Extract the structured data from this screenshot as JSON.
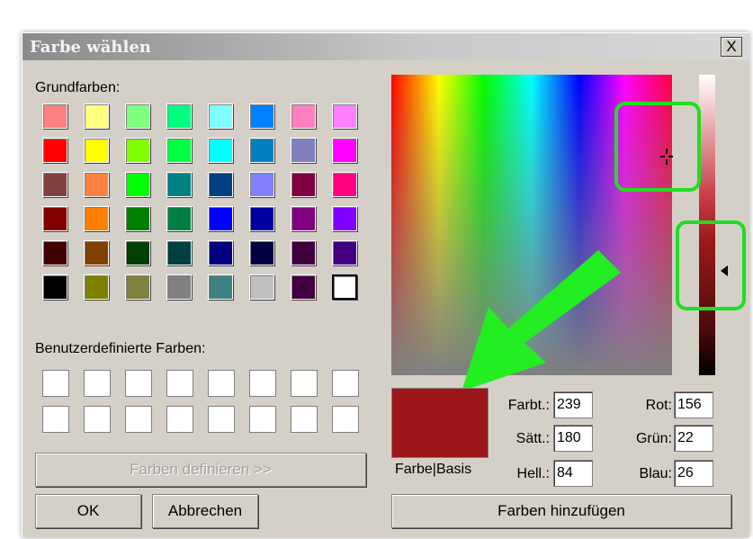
{
  "dialog": {
    "title": "Farbe wählen",
    "close_label": "X",
    "basic_colors_label": "Grundfarben:",
    "custom_colors_label": "Benutzerdefinierte Farben:",
    "define_button": "Farben definieren >>",
    "ok_button": "OK",
    "cancel_button": "Abbrechen",
    "add_button": "Farben hinzufügen",
    "preview_label": "Farbe|Basis"
  },
  "basic_colors": [
    [
      "#ff8080",
      "#ffff80",
      "#80ff80",
      "#00ff80",
      "#80ffff",
      "#0080ff",
      "#ff80c0",
      "#ff80ff"
    ],
    [
      "#ff0000",
      "#ffff00",
      "#80ff00",
      "#00ff40",
      "#00ffff",
      "#0080c0",
      "#8080c0",
      "#ff00ff"
    ],
    [
      "#804040",
      "#ff8040",
      "#00ff00",
      "#008080",
      "#004080",
      "#8080ff",
      "#800040",
      "#ff0080"
    ],
    [
      "#800000",
      "#ff8000",
      "#008000",
      "#008040",
      "#0000ff",
      "#0000a0",
      "#800080",
      "#8000ff"
    ],
    [
      "#400000",
      "#804000",
      "#004000",
      "#004040",
      "#000080",
      "#000040",
      "#400040",
      "#400080"
    ],
    [
      "#000000",
      "#808000",
      "#808040",
      "#808080",
      "#408080",
      "#c0c0c0",
      "#400040",
      "#ffffff"
    ]
  ],
  "fields": {
    "hue": {
      "label": "Farbt.:",
      "value": "239"
    },
    "sat": {
      "label": "Sätt.:",
      "value": "180"
    },
    "lum": {
      "label": "Hell.:",
      "value": "84"
    },
    "red": {
      "label": "Rot:",
      "value": "156"
    },
    "green": {
      "label": "Grün:",
      "value": "22"
    },
    "blue": {
      "label": "Blau:",
      "value": "26"
    }
  },
  "colors": {
    "selected_color": "#9c161a",
    "annotation_green": "#22dd22",
    "dialog_face": "#d4d0c8"
  }
}
